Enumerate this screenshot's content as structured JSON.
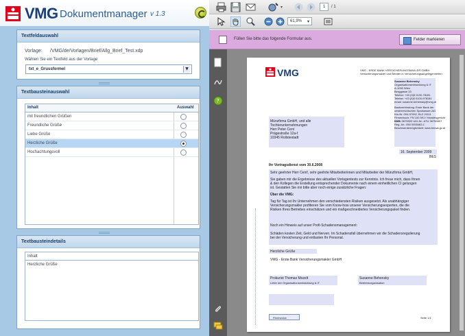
{
  "brand": {
    "word": "VMG",
    "app_name": "Dokumentmanager",
    "version": "v 1.3"
  },
  "panel_source": {
    "title": "Textfeldauswahl",
    "vorlage_label": "Vorlage:",
    "vorlage_path": "/VMG/de/Vorlagen/Brief/Allg_Brief_Test.xdp",
    "hint": "Wählen Sie ein Textfeld aus der Vorlage",
    "selected": "txt_e_Grussformel"
  },
  "panel_blocks": {
    "title": "Textbausteinauswahl",
    "col_content": "Inhalt",
    "col_select": "Auswahl",
    "rows": [
      {
        "label": "mit freundlichen Grüßen",
        "selected": false
      },
      {
        "label": "Freundliche Grüße",
        "selected": false
      },
      {
        "label": "Liebe Grüße",
        "selected": false
      },
      {
        "label": "Herzliche Grüße",
        "selected": true
      },
      {
        "label": "Hochachtungsvoll",
        "selected": false
      }
    ]
  },
  "panel_detail": {
    "title": "Textbausteindetails",
    "header": "Inhalt",
    "text": "Herzliche Grüße"
  },
  "viewer": {
    "page_current": "1",
    "page_total": "/ 1",
    "zoom": "61,9%",
    "form_message": "Füllen Sie bitte das folgende Formular aus.",
    "highlight_button": "Felder markieren"
  },
  "document": {
    "logo": "VMG",
    "sender_line1": "VMG - ERDE BANK VERSICHERUNGSMAKLER GMBH",
    "sender_line2": "Versicherungsmakler und Berater in Versicherungsangelegenheiten",
    "contact_name": "Susanne Behensky",
    "contact_dept": "Organisationsentwicklung & IT",
    "contact_addr1": "A-1090 Wien",
    "contact_addr2": "Berggasse 33",
    "contact_tel": "Telefon: +43 (0)5 0100-78181",
    "contact_fax": "Telefax: +43 (0)5 0100-978181",
    "contact_mail": "email: susanne.behensky@vmg.at",
    "bank1": "Bankverbindung: Erste Bank der",
    "bank2": "oesterreichischen Sparkassen AG",
    "bank3": "Kto-Nr. 004-07092, BLZ 20111",
    "bank4": "Firmenbuch: FN 100 591 f Handelsgericht Wien",
    "bank5": "DVR: 0675903 UID-Nr.: ATU 36756807",
    "bank6": "Reg.-Nr.: 050 0055463-1",
    "bank7": "Beschwerdemöglichkeit: www.bmwa.gv.at",
    "recipient1": "Münzfirma GmbH, und alle",
    "recipient2": "Tochterunternehmungen",
    "recipient3": "Herr Peter Cent",
    "recipient4": "Prägestraße 12a-f",
    "recipient5": "10345 Rollstestadt",
    "date": "16. September 2009",
    "ref": "BES",
    "subject": "Ihr Vortragsdienst vom 30.6.2008",
    "salutation": "Sehr geehrter Herr Cent!, sehr geehrte Mitarbeiterinnen und Mitarbeiter der Münzfirma GmbH,",
    "p1a": "Sie gaben mir die Ergebnisse des aktuellen Vorlagentests zur Kenntnis. Ich freue mich, dass Ihnen",
    "p1b": "& den Kollegen die Erstellung entsprechender Dokumente nach einem einheitlichen CI gelungen",
    "p1c": "ist. Gestatten Sie mir bitte aber noch einige zusätzliche Fragen:",
    "h2": "Über die VMG:",
    "p2a": "Tag für Tag ist Ihr Unternehmen den verschiedensten Risiken ausgesetzt. Als unabhängiger",
    "p2b": "Versicherungsmakler profitieren Sie vom Know-how unserer Versicherungsexperten, die die",
    "p2c": "Risiken Ihres Betriebes einschätzen und ein maßgeschneidertes Versicherungspaket finden.",
    "p3": "Noch ein Hinweis auf unser Profi-Schadensmanagement:",
    "p4a": "Schäden kosten Zeit, Geld und Nerven. Im Schadensfall übernehmen wir die Schadensregulierung",
    "p4b": "bei der Versicherung und entlasten Ihr Personal.",
    "closing": "Herzliche Grüße",
    "company": "VMG - Erste Bank Versicherungsmakler GmbH",
    "sig1_name": "Prokurist Thomas Mozelt",
    "sig1_title": "Leiter der Organisationsentwicklung & IT",
    "sig2_name": "Susanne Behensky",
    "sig2_title": "Betriebsorganisation",
    "print_button": "Flexinvoice",
    "page_label": "Seite 1/1"
  }
}
